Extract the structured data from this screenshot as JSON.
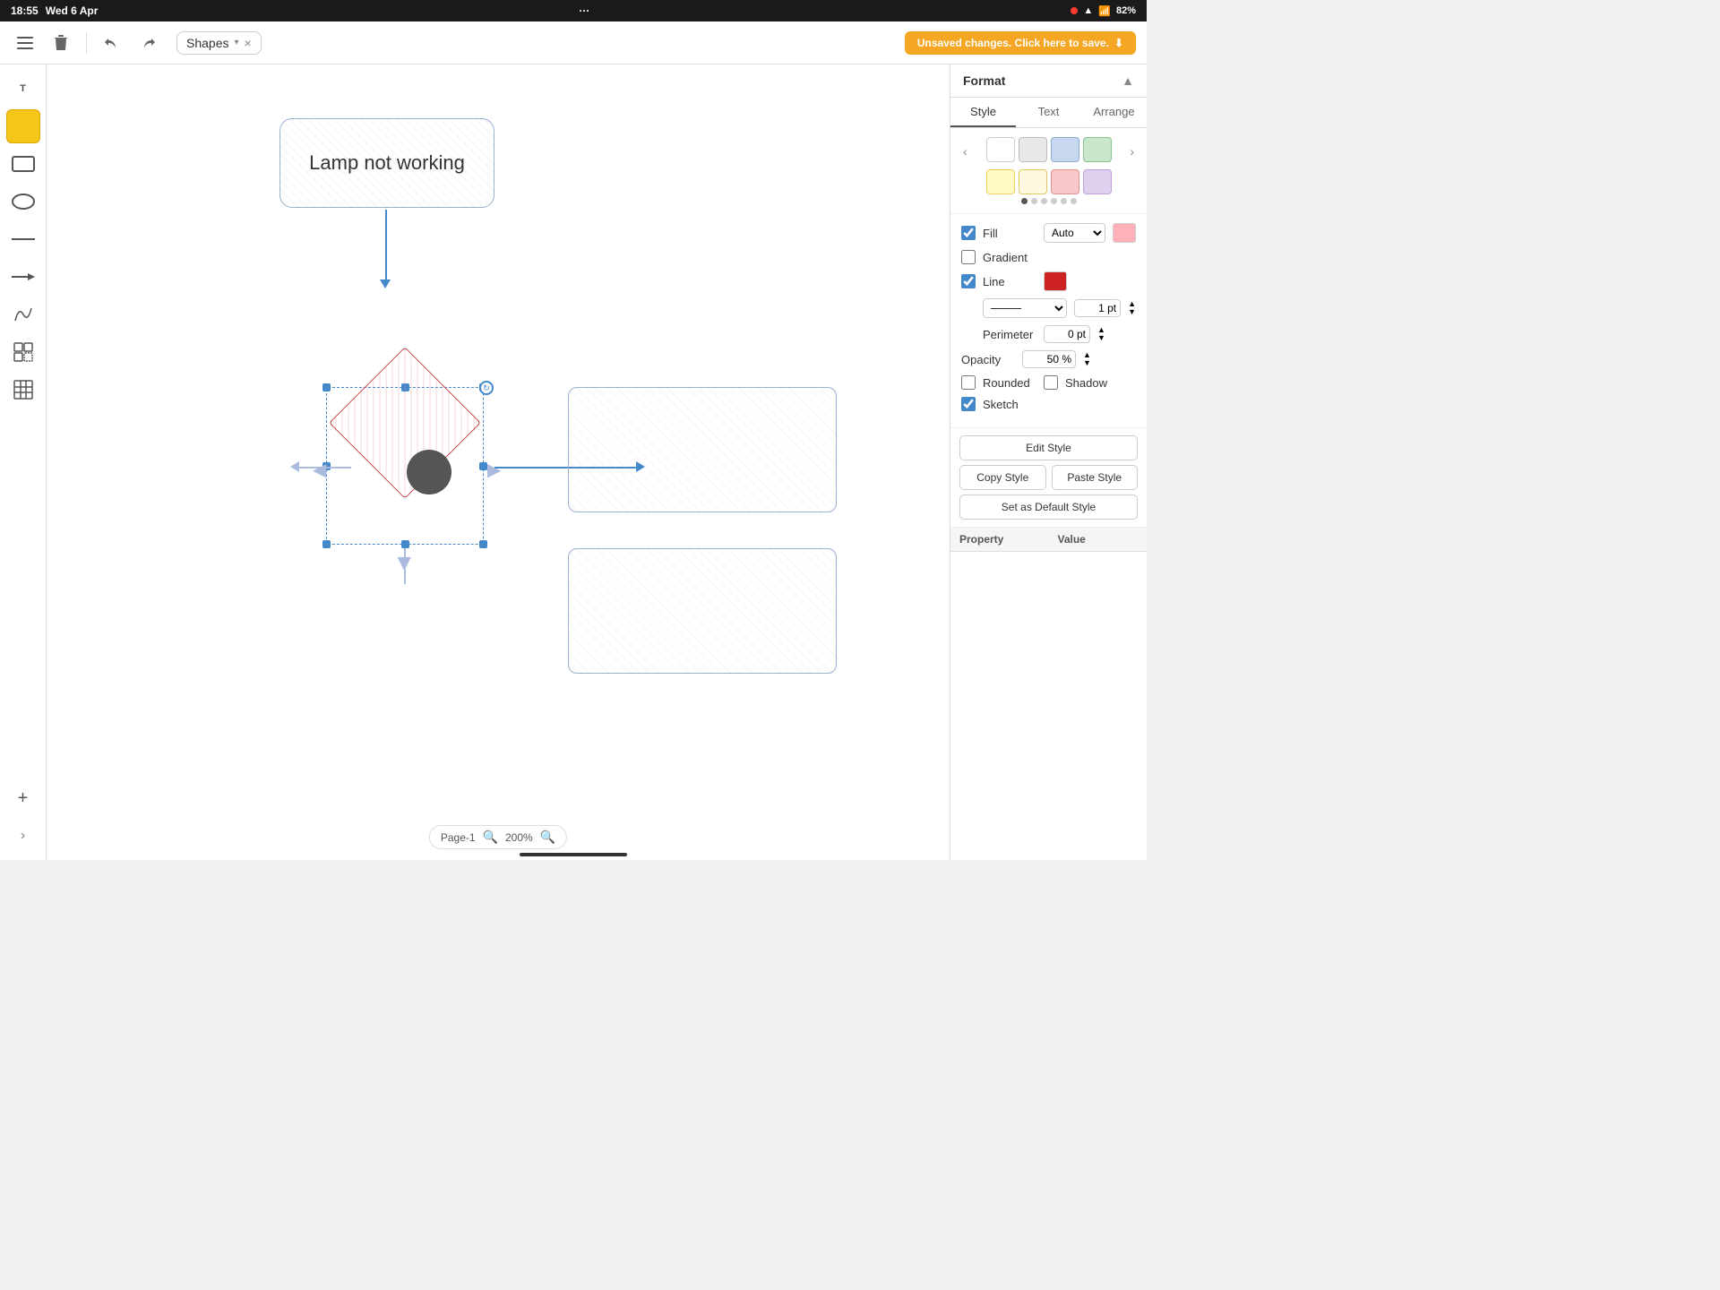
{
  "statusBar": {
    "time": "18:55",
    "date": "Wed 6 Apr",
    "dots": "···",
    "batteryPercent": "82%"
  },
  "toolbar": {
    "filename": "Shapes",
    "saveBanner": "Unsaved changes. Click here to save.",
    "menuIcon": "☰",
    "deleteIcon": "🗑",
    "undoIcon": "↩",
    "redoIcon": "↪"
  },
  "canvas": {
    "lampBox": {
      "text": "Lamp not working"
    }
  },
  "rightPanel": {
    "title": "Format",
    "tabs": [
      "Style",
      "Text",
      "Arrange"
    ],
    "activeTab": "Style",
    "fillLabel": "Fill",
    "fillOption": "Auto",
    "gradientLabel": "Gradient",
    "lineLabel": "Line",
    "linePt": "1 pt",
    "perimeterLabel": "Perimeter",
    "perimeterPt": "0 pt",
    "opacityLabel": "Opacity",
    "opacityValue": "50 %",
    "roundedLabel": "Rounded",
    "shadowLabel": "Shadow",
    "sketchLabel": "Sketch",
    "editStyleBtn": "Edit Style",
    "copyStyleBtn": "Copy Style",
    "pasteStyleBtn": "Paste Style",
    "setDefaultBtn": "Set as Default Style",
    "propertyCol": "Property",
    "valueCol": "Value"
  },
  "pageIndicator": {
    "label": "Page-1",
    "zoom": "200%"
  }
}
